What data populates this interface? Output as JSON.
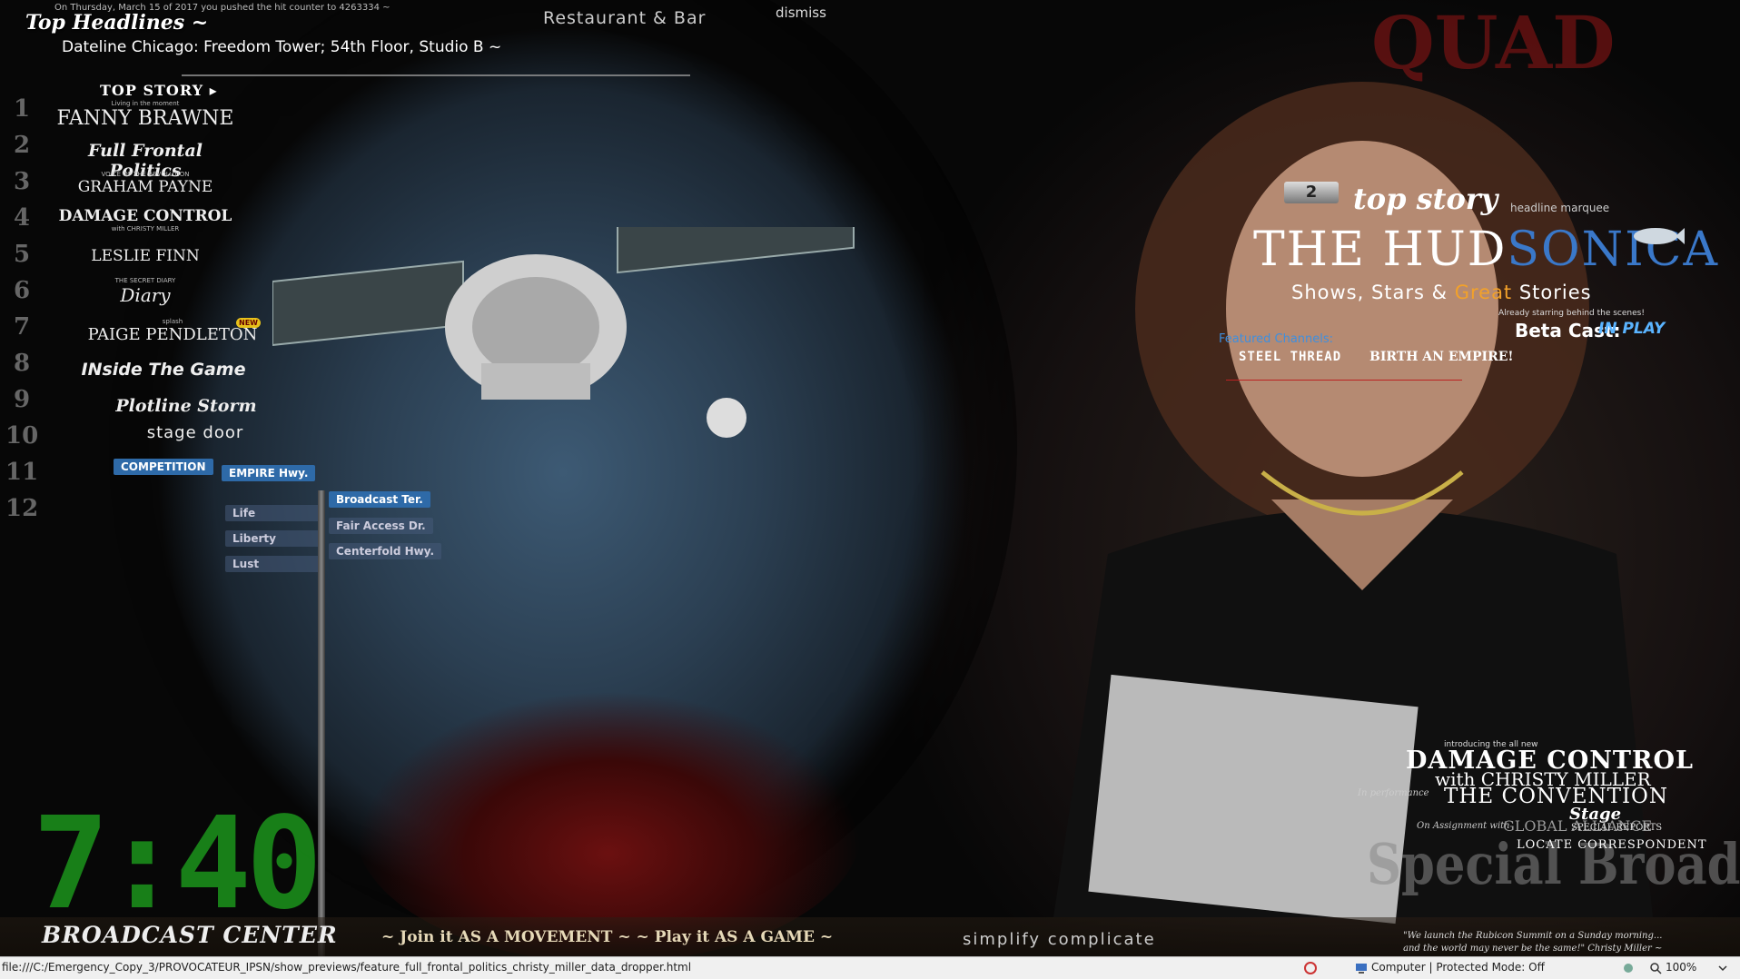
{
  "header": {
    "date_line": "On Thursday, March 15 of 2017 you pushed the hit counter to 4263334 ~",
    "top_headlines": "Top Headlines ~",
    "dateline": "Dateline Chicago: Freedom Tower; 54th Floor, Studio B ~",
    "restaurant": "Restaurant & Bar",
    "dismiss": "dismiss"
  },
  "menu": {
    "top_story": "TOP STORY ▸",
    "numbers": [
      "1",
      "2",
      "3",
      "4",
      "5",
      "6",
      "7",
      "8",
      "9",
      "10",
      "11",
      "12"
    ],
    "items": [
      {
        "label": "FANNY BRAWNE",
        "sub": "Living in the moment"
      },
      {
        "label": "Full Frontal Politics",
        "sub": ""
      },
      {
        "label": "GRAHAM PAYNE",
        "sub": "VOICE OF THE REVOLUTION"
      },
      {
        "label": "DAMAGE CONTROL",
        "sub": "with CHRISTY MILLER"
      },
      {
        "label": "LESLIE FINN",
        "sub": ""
      },
      {
        "label": "Diary",
        "sub": "THE SECRET DIARY"
      },
      {
        "label": "PAIGE PENDLETON",
        "sub": "splash",
        "badge": "NEW"
      },
      {
        "label": "INside The Game",
        "sub": ""
      },
      {
        "label": "Plotline Storm",
        "sub": ""
      },
      {
        "label": "stage door",
        "sub": ""
      }
    ]
  },
  "streets": {
    "competition": "COMPETITION",
    "empire": "EMPIRE Hwy.",
    "broadcast": "Broadcast Ter.",
    "life": "Life",
    "liberty": "Liberty",
    "lust": "Lust",
    "fairaccess": "Fair Access Dr.",
    "centerfold": "Centerfold Hwy."
  },
  "clock": "7:40",
  "footer": {
    "broadcast_center": "BROADCAST CENTER",
    "join": "~ Join it AS A MOVEMENT ~ ~ Play it AS A GAME ~",
    "simplify": "simplify complicate",
    "quote_line1": "\"We launch the Rubicon Summit on a Sunday morning...",
    "quote_line2": "and the world may never be the same!\" Christy Miller ~"
  },
  "marquee": {
    "number": "2",
    "top_story": "top story",
    "headline_marquee": "headline marquee",
    "title_white": "THE HUD",
    "title_blue": "SONICA",
    "shows_a": "Shows, Stars & ",
    "shows_great": "Great",
    "shows_b": " Stories",
    "already": "Already starring behind the scenes!",
    "beta_cast": "Beta Cast:",
    "in_play": "IN PLAY",
    "featured_channels": "Featured Channels:",
    "steel_thread": "STEEL THREAD",
    "birth_empire": "BIRTH AN EMPIRE!"
  },
  "lower_right": {
    "intro": "introducing the all new",
    "damage_control": "DAMAGE CONTROL",
    "with_christy": "with CHRISTY MILLER",
    "in_performance": "In performance",
    "convention": "THE CONVENTION",
    "stage": "Stage",
    "on_assignment": "On Assignment with",
    "global_alliance": "GLOBAL ALLIANCE",
    "special_reports": "SPECIAL REPORTS",
    "locate": "LOCATE CORRESPONDENT",
    "special_broadcast": "Special Broadcast"
  },
  "statusbar": {
    "url": "file:///C:/Emergency_Copy_3/PROVOCATEUR_IPSN/show_previews/feature_full_frontal_politics_christy_miller_data_dropper.html",
    "zone": "Computer | Protected Mode: Off",
    "zoom": "100%"
  },
  "colors": {
    "accent_blue": "#3a78c9",
    "great_orange": "#f2a12a",
    "clock_green": "#1ea81e",
    "street_blue": "#2e6aa8"
  }
}
